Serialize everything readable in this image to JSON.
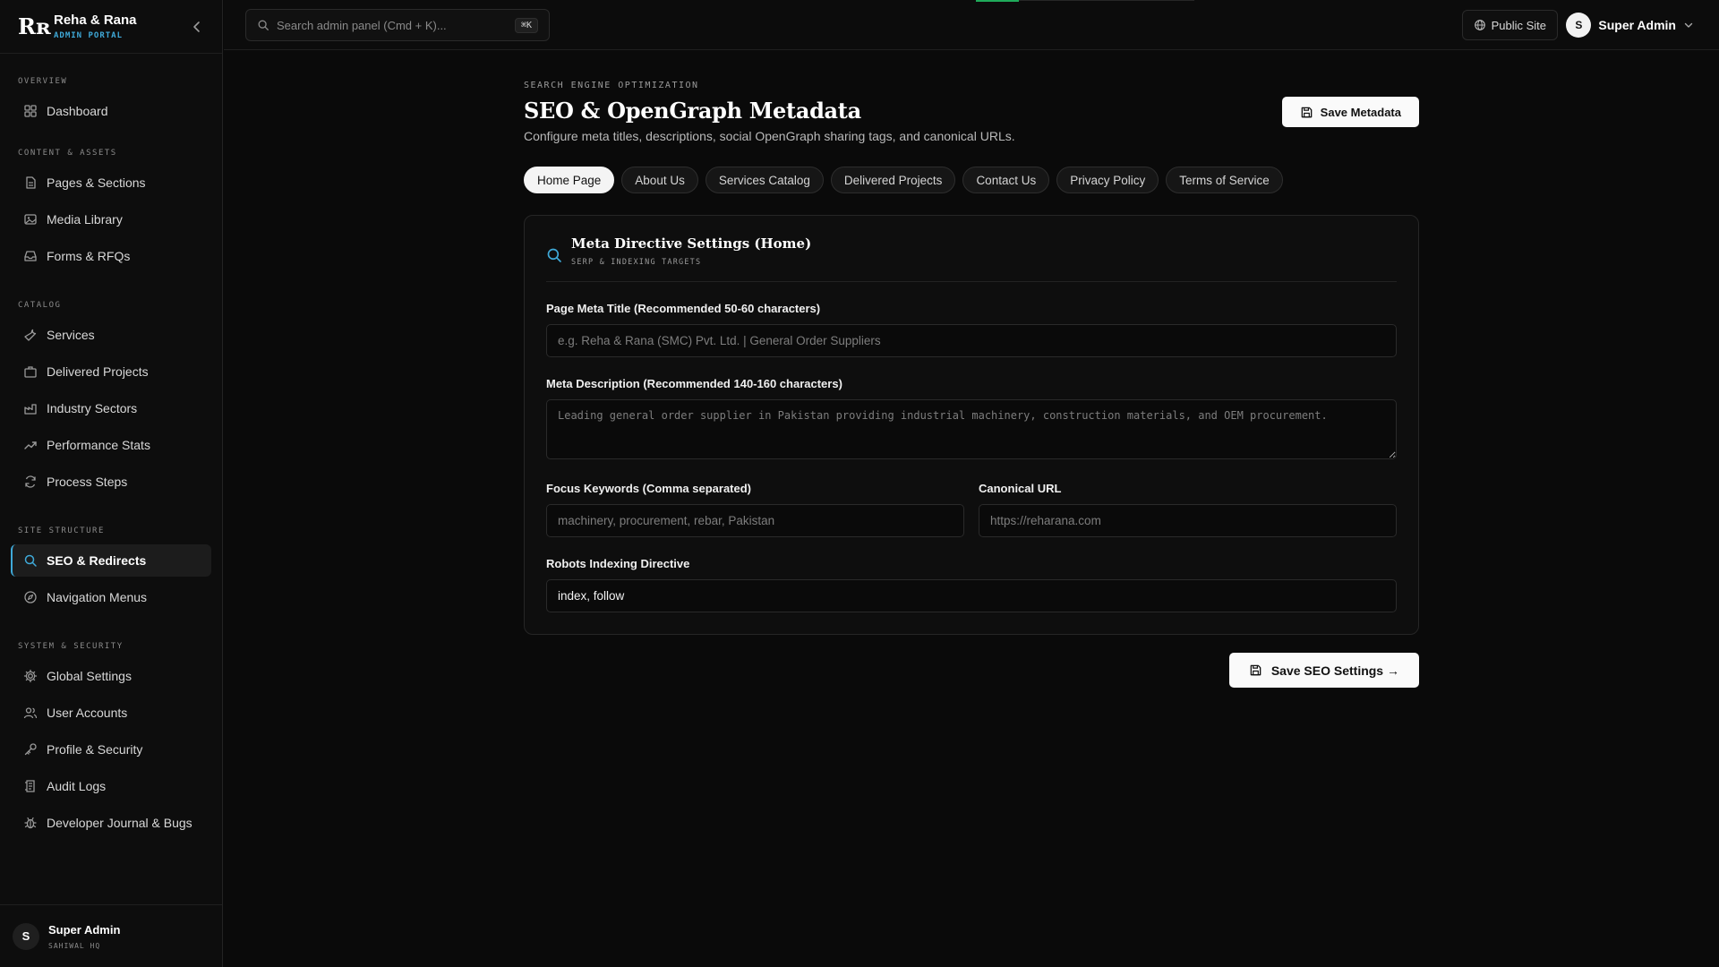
{
  "brand": {
    "name": "Reha & Rana",
    "subtitle": "ADMIN PORTAL",
    "logo": "Rʀ"
  },
  "search": {
    "placeholder": "Search admin panel (Cmd + K)...",
    "shortcut": "⌘K"
  },
  "topbar": {
    "public_site": "Public Site",
    "user_initial": "S",
    "user_name": "Super Admin"
  },
  "sidebar": {
    "sections": [
      {
        "title": "OVERVIEW",
        "items": [
          {
            "label": "Dashboard",
            "icon": "grid-icon"
          }
        ]
      },
      {
        "title": "CONTENT & ASSETS",
        "items": [
          {
            "label": "Pages & Sections",
            "icon": "file-icon"
          },
          {
            "label": "Media Library",
            "icon": "image-icon"
          },
          {
            "label": "Forms & RFQs",
            "icon": "inbox-icon"
          }
        ]
      },
      {
        "title": "CATALOG",
        "items": [
          {
            "label": "Services",
            "icon": "wrench-icon"
          },
          {
            "label": "Delivered Projects",
            "icon": "building-icon"
          },
          {
            "label": "Industry Sectors",
            "icon": "factory-icon"
          },
          {
            "label": "Performance Stats",
            "icon": "trending-up-icon"
          },
          {
            "label": "Process Steps",
            "icon": "refresh-icon"
          }
        ]
      },
      {
        "title": "SITE STRUCTURE",
        "items": [
          {
            "label": "SEO & Redirects",
            "icon": "search-icon"
          },
          {
            "label": "Navigation Menus",
            "icon": "compass-icon"
          }
        ]
      },
      {
        "title": "SYSTEM & SECURITY",
        "items": [
          {
            "label": "Global Settings",
            "icon": "gear-icon"
          },
          {
            "label": "User Accounts",
            "icon": "users-icon"
          },
          {
            "label": "Profile & Security",
            "icon": "key-icon"
          },
          {
            "label": "Audit Logs",
            "icon": "log-icon"
          },
          {
            "label": "Developer Journal & Bugs",
            "icon": "bug-icon"
          }
        ]
      }
    ],
    "footer": {
      "initial": "S",
      "name": "Super Admin",
      "location": "SAHIWAL HQ"
    }
  },
  "page": {
    "eyebrow": "SEARCH ENGINE OPTIMIZATION",
    "title": "SEO & OpenGraph Metadata",
    "description": "Configure meta titles, descriptions, social OpenGraph sharing tags, and canonical URLs.",
    "save_metadata": "Save Metadata",
    "tabs": [
      "Home Page",
      "About Us",
      "Services Catalog",
      "Delivered Projects",
      "Contact Us",
      "Privacy Policy",
      "Terms of Service"
    ],
    "active_tab": 0
  },
  "card": {
    "title": "Meta Directive Settings (Home)",
    "subtitle": "SERP & INDEXING TARGETS",
    "meta_title": {
      "label": "Page Meta Title (Recommended 50-60 characters)",
      "placeholder": "e.g. Reha & Rana (SMC) Pvt. Ltd. | General Order Suppliers",
      "value": ""
    },
    "meta_description": {
      "label": "Meta Description (Recommended 140-160 characters)",
      "placeholder": "Leading general order supplier in Pakistan providing industrial machinery, construction materials, and OEM procurement.",
      "value": ""
    },
    "keywords": {
      "label": "Focus Keywords (Comma separated)",
      "placeholder": "machinery, procurement, rebar, Pakistan",
      "value": ""
    },
    "canonical": {
      "label": "Canonical URL",
      "placeholder": "https://reharana.com",
      "value": ""
    },
    "robots": {
      "label": "Robots Indexing Directive",
      "value": "index, follow"
    }
  },
  "save_seo": "Save SEO Settings →",
  "colors": {
    "accent": "#3fa9d8",
    "background": "#0a0a0a",
    "progress": "#1faa5a"
  }
}
